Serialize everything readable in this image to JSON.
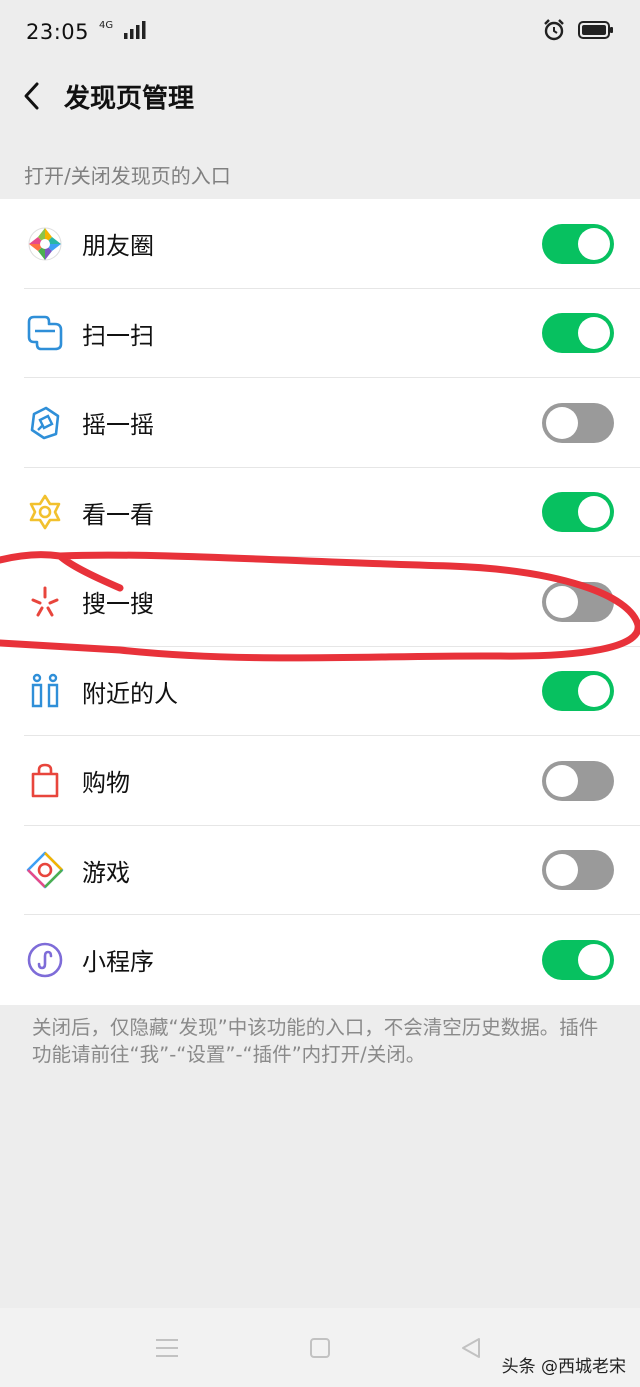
{
  "status_bar": {
    "time": "23:05",
    "network": "4G"
  },
  "header": {
    "title": "发现页管理"
  },
  "section_label": "打开/关闭发现页的入口",
  "items": [
    {
      "label": "朋友圈",
      "icon": "moments-icon",
      "on": true
    },
    {
      "label": "扫一扫",
      "icon": "scan-icon",
      "on": true
    },
    {
      "label": "摇一摇",
      "icon": "shake-icon",
      "on": false
    },
    {
      "label": "看一看",
      "icon": "top-stories-icon",
      "on": true
    },
    {
      "label": "搜一搜",
      "icon": "search-icon",
      "on": false
    },
    {
      "label": "附近的人",
      "icon": "people-nearby-icon",
      "on": true
    },
    {
      "label": "购物",
      "icon": "shopping-bag-icon",
      "on": false
    },
    {
      "label": "游戏",
      "icon": "games-icon",
      "on": false
    },
    {
      "label": "小程序",
      "icon": "mini-program-icon",
      "on": true
    }
  ],
  "note": "关闭后，仅隐藏“发现”中该功能的入口，不会清空历史数据。插件功能请前往“我”-“设置”-“插件”内打开/关闭。",
  "watermark": "头条 @西城老宋",
  "colors": {
    "toggle_on": "#07c160",
    "toggle_off": "#9a9a9a",
    "annotation": "#e8323a"
  }
}
